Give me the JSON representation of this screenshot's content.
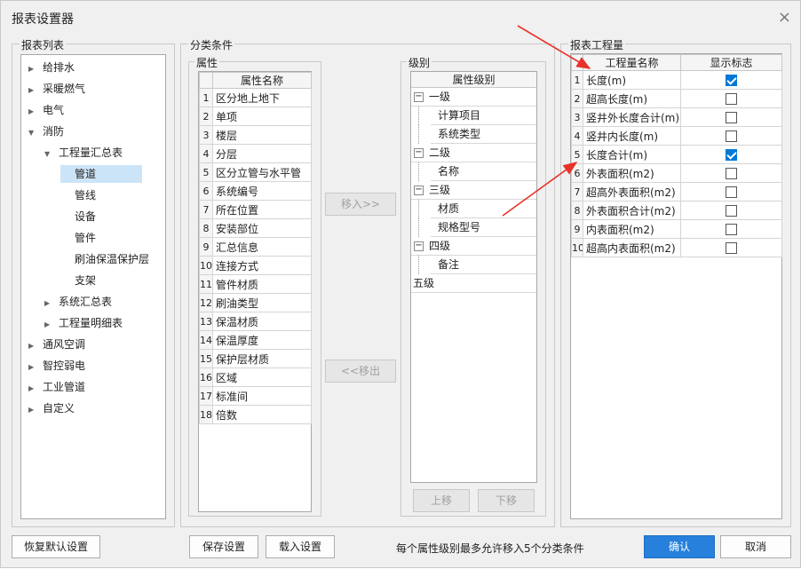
{
  "title": "报表设置器",
  "groups": {
    "report_list": "报表列表",
    "classification": "分类条件",
    "attributes": "属性",
    "levels": "级别",
    "quantities": "报表工程量"
  },
  "tree": [
    {
      "label": "给排水",
      "arrow": "▶"
    },
    {
      "label": "采暖燃气",
      "arrow": "▶"
    },
    {
      "label": "电气",
      "arrow": "▶"
    },
    {
      "label": "消防",
      "arrow": "▼"
    },
    {
      "label": "工程量汇总表",
      "arrow": "▼"
    },
    {
      "label": "管道",
      "arrow": ""
    },
    {
      "label": "管线",
      "arrow": ""
    },
    {
      "label": "设备",
      "arrow": ""
    },
    {
      "label": "管件",
      "arrow": ""
    },
    {
      "label": "刷油保温保护层",
      "arrow": ""
    },
    {
      "label": "支架",
      "arrow": ""
    },
    {
      "label": "系统汇总表",
      "arrow": "▶"
    },
    {
      "label": "工程量明细表",
      "arrow": "▶"
    },
    {
      "label": "通风空调",
      "arrow": "▶"
    },
    {
      "label": "智控弱电",
      "arrow": "▶"
    },
    {
      "label": "工业管道",
      "arrow": "▶"
    },
    {
      "label": "自定义",
      "arrow": "▶"
    }
  ],
  "attributes": {
    "header": "属性名称",
    "rows": [
      "区分地上地下",
      "单项",
      "楼层",
      "分层",
      "区分立管与水平管",
      "系统编号",
      "所在位置",
      "安装部位",
      "汇总信息",
      "连接方式",
      "管件材质",
      "刷油类型",
      "保温材质",
      "保温厚度",
      "保护层材质",
      "区域",
      "标准间",
      "倍数"
    ]
  },
  "levels": {
    "header": "属性级别",
    "items": [
      {
        "label": "一级",
        "type": "level"
      },
      {
        "label": "计算项目",
        "type": "child"
      },
      {
        "label": "系统类型",
        "type": "child"
      },
      {
        "label": "二级",
        "type": "level"
      },
      {
        "label": "名称",
        "type": "child"
      },
      {
        "label": "三级",
        "type": "level"
      },
      {
        "label": "材质",
        "type": "child"
      },
      {
        "label": "规格型号",
        "type": "child"
      },
      {
        "label": "四级",
        "type": "level"
      },
      {
        "label": "备注",
        "type": "child"
      },
      {
        "label": "五级",
        "type": "plain"
      }
    ],
    "expander": "−"
  },
  "quantities": {
    "header_name": "工程量名称",
    "header_flag": "显示标志",
    "rows": [
      {
        "name": "长度(m)",
        "checked": true
      },
      {
        "name": "超高长度(m)",
        "checked": false
      },
      {
        "name": "竖井外长度合计(m)",
        "checked": false
      },
      {
        "name": "竖井内长度(m)",
        "checked": false
      },
      {
        "name": "长度合计(m)",
        "checked": true
      },
      {
        "name": "外表面积(m2)",
        "checked": false
      },
      {
        "name": "超高外表面积(m2)",
        "checked": false
      },
      {
        "name": "外表面积合计(m2)",
        "checked": false
      },
      {
        "name": "内表面积(m2)",
        "checked": false
      },
      {
        "name": "超高内表面积(m2)",
        "checked": false
      }
    ]
  },
  "buttons": {
    "move_in": "移入>>",
    "move_out": "<<移出",
    "move_up": "上移",
    "move_down": "下移",
    "restore": "恢复默认设置",
    "save": "保存设置",
    "load": "载入设置",
    "confirm": "确认",
    "cancel": "取消"
  },
  "note": "每个属性级别最多允许移入5个分类条件",
  "icons": {
    "close": "×"
  },
  "colors": {
    "accent": "#2680dc",
    "selection": "#cce4f7",
    "arrow": "#e8322a",
    "check": "#0078d4"
  }
}
